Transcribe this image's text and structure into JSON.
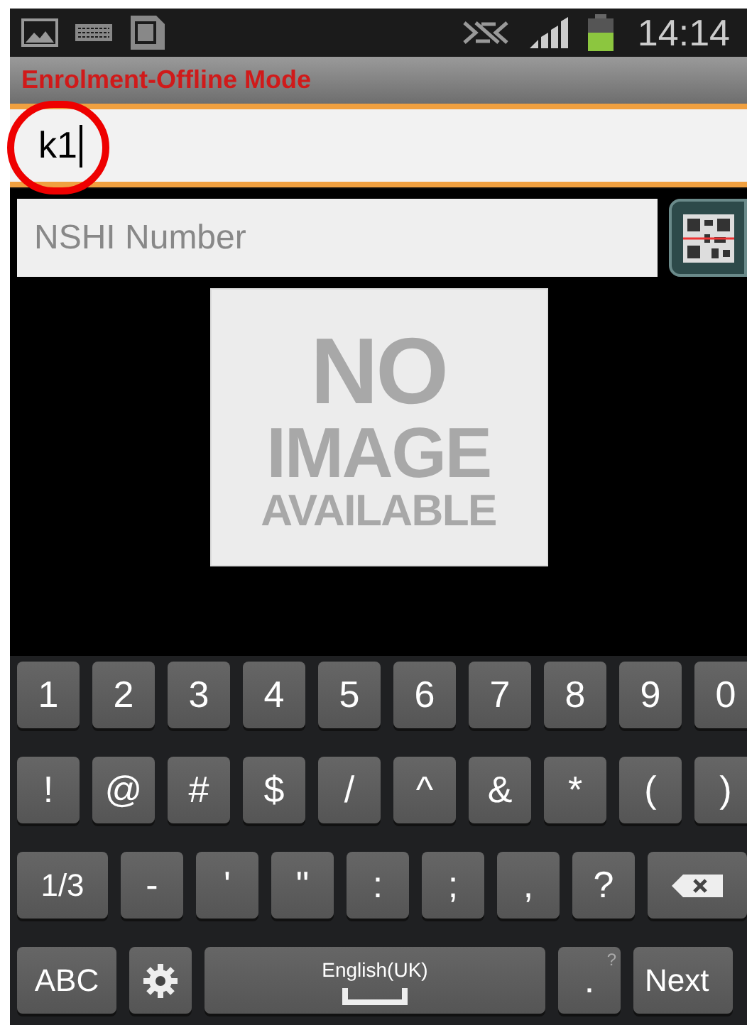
{
  "status_bar": {
    "time": "14:14"
  },
  "title": "Enrolment-Offline Mode",
  "enrolment_field": {
    "value": "k1",
    "focused": true,
    "highlighted": true
  },
  "nshi_field": {
    "placeholder": "NSHI Number"
  },
  "photo_placeholder": {
    "lines": [
      "NO",
      "IMAGE",
      "AVAILABLE"
    ]
  },
  "keyboard": {
    "number_row": [
      {
        "kind": "char",
        "label": "1"
      },
      {
        "kind": "char",
        "label": "2"
      },
      {
        "kind": "char",
        "label": "3"
      },
      {
        "kind": "char",
        "label": "4"
      },
      {
        "kind": "char",
        "label": "5"
      },
      {
        "kind": "char",
        "label": "6"
      },
      {
        "kind": "char",
        "label": "7"
      },
      {
        "kind": "char",
        "label": "8"
      },
      {
        "kind": "char",
        "label": "9"
      },
      {
        "kind": "char",
        "label": "0"
      }
    ],
    "symbol_row": [
      {
        "kind": "char",
        "label": "!"
      },
      {
        "kind": "char",
        "label": "@"
      },
      {
        "kind": "char",
        "label": "#"
      },
      {
        "kind": "char",
        "label": "$"
      },
      {
        "kind": "char",
        "label": "/"
      },
      {
        "kind": "char",
        "label": "^"
      },
      {
        "kind": "char",
        "label": "&"
      },
      {
        "kind": "char",
        "label": "*"
      },
      {
        "kind": "char",
        "label": "("
      },
      {
        "kind": "char",
        "label": ")"
      }
    ],
    "punctuation_row": [
      {
        "kind": "mode",
        "label": "1/3"
      },
      {
        "kind": "char",
        "label": "-"
      },
      {
        "kind": "char",
        "label": "'"
      },
      {
        "kind": "char",
        "label": "\""
      },
      {
        "kind": "char",
        "label": ":"
      },
      {
        "kind": "char",
        "label": ";"
      },
      {
        "kind": "char",
        "label": ","
      },
      {
        "kind": "char",
        "label": "?"
      },
      {
        "kind": "backspace"
      }
    ],
    "bottom_row": [
      {
        "kind": "mode",
        "label": "ABC"
      },
      {
        "kind": "settings"
      },
      {
        "kind": "space",
        "label": "English(UK)"
      },
      {
        "kind": "char",
        "label": ".",
        "hint": "?"
      },
      {
        "kind": "action",
        "label": "Next"
      }
    ]
  }
}
